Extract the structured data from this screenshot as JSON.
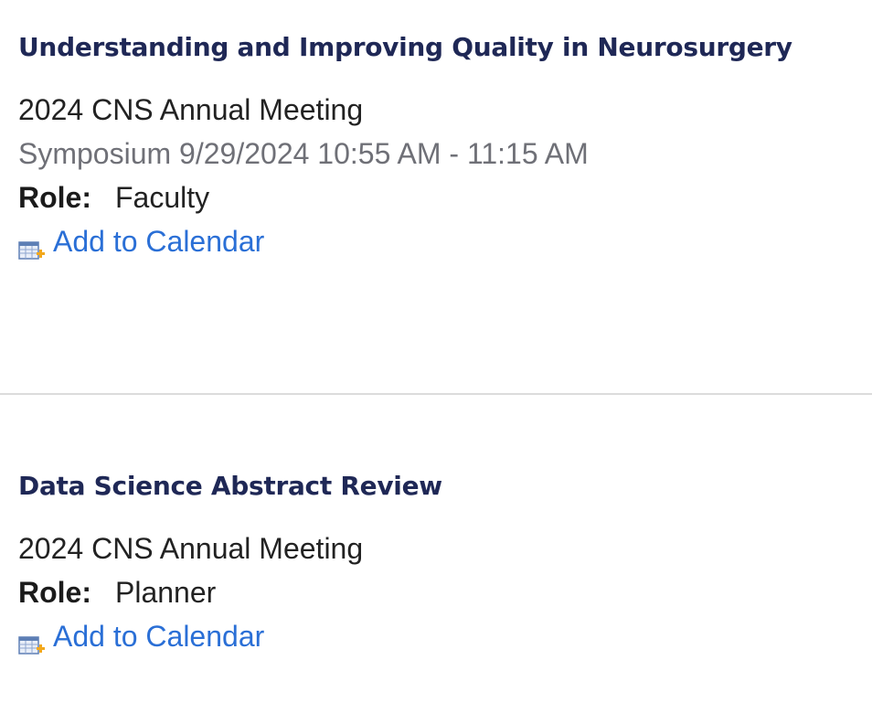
{
  "entries": [
    {
      "title": "Understanding and Improving Quality in Neurosurgery",
      "meeting": "2024 CNS Annual Meeting",
      "session": "Symposium 9/29/2024 10:55 AM - 11:15 AM",
      "role_label": "Role:",
      "role_value": "Faculty",
      "calendar_icon": "calendar-add-icon",
      "calendar_label": "Add to Calendar"
    },
    {
      "title": "Data Science Abstract Review",
      "meeting": "2024 CNS Annual Meeting",
      "role_label": "Role:",
      "role_value": "Planner",
      "calendar_icon": "calendar-add-icon",
      "calendar_label": "Add to Calendar"
    }
  ],
  "colors": {
    "title": "#1f2856",
    "link": "#2a6fd6",
    "meta": "#6f7077",
    "divider": "#dcdcdc",
    "icon_accent": "#f2a81d"
  }
}
